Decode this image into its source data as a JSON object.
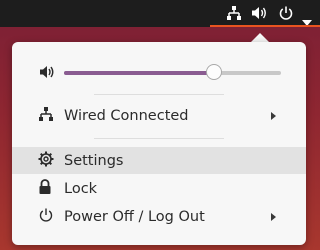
{
  "top_bar": {
    "tray_icons": [
      "network-wired-icon",
      "volume-icon",
      "power-icon",
      "dropdown-arrow-icon"
    ],
    "accent_color": "#e95420"
  },
  "menu": {
    "volume": {
      "icon": "volume-icon",
      "level_fraction": 0.69,
      "fill_color": "#8a5c91"
    },
    "items": [
      {
        "label": "Wired Connected",
        "icon": "network-wired-icon",
        "has_submenu": true
      },
      {
        "label": "Settings",
        "icon": "gear-icon",
        "has_submenu": false,
        "highlighted": true
      },
      {
        "label": "Lock",
        "icon": "lock-icon",
        "has_submenu": false
      },
      {
        "label": "Power Off / Log Out",
        "icon": "power-icon",
        "has_submenu": true
      }
    ]
  }
}
